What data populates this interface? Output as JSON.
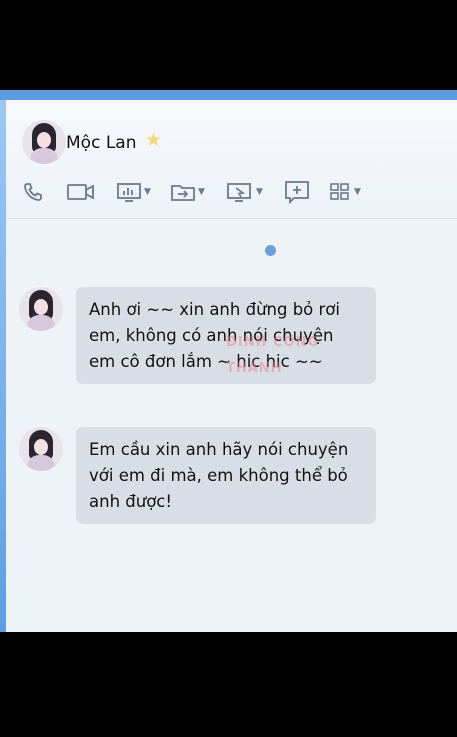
{
  "contact": {
    "name": "Mộc Lan",
    "badge_icon": "star-icon"
  },
  "toolbar": {
    "items": [
      {
        "icon": "phone-icon"
      },
      {
        "icon": "video-call-icon"
      },
      {
        "icon": "screen-share-icon",
        "dropdown": true
      },
      {
        "icon": "file-transfer-icon",
        "dropdown": true
      },
      {
        "icon": "remote-desktop-icon",
        "dropdown": true
      },
      {
        "icon": "add-icon"
      },
      {
        "icon": "apps-grid-icon",
        "dropdown": true
      }
    ]
  },
  "messages": [
    {
      "sender": "Mộc Lan",
      "text": "Anh ơi ~~ xin anh đừng bỏ rơi em, không có anh nói chuyện em cô đơn lắm ~ hic hic ~~"
    },
    {
      "sender": "Mộc Lan",
      "text": "Em cầu xin anh hãy nói chuyện với em đi mà, em không thể bỏ anh được!"
    }
  ],
  "watermark": "ĐINH CÔNG THÀNH",
  "colors": {
    "accent": "#5c9de0",
    "bubble": "#d9dee6",
    "background": "#eef3f8"
  }
}
